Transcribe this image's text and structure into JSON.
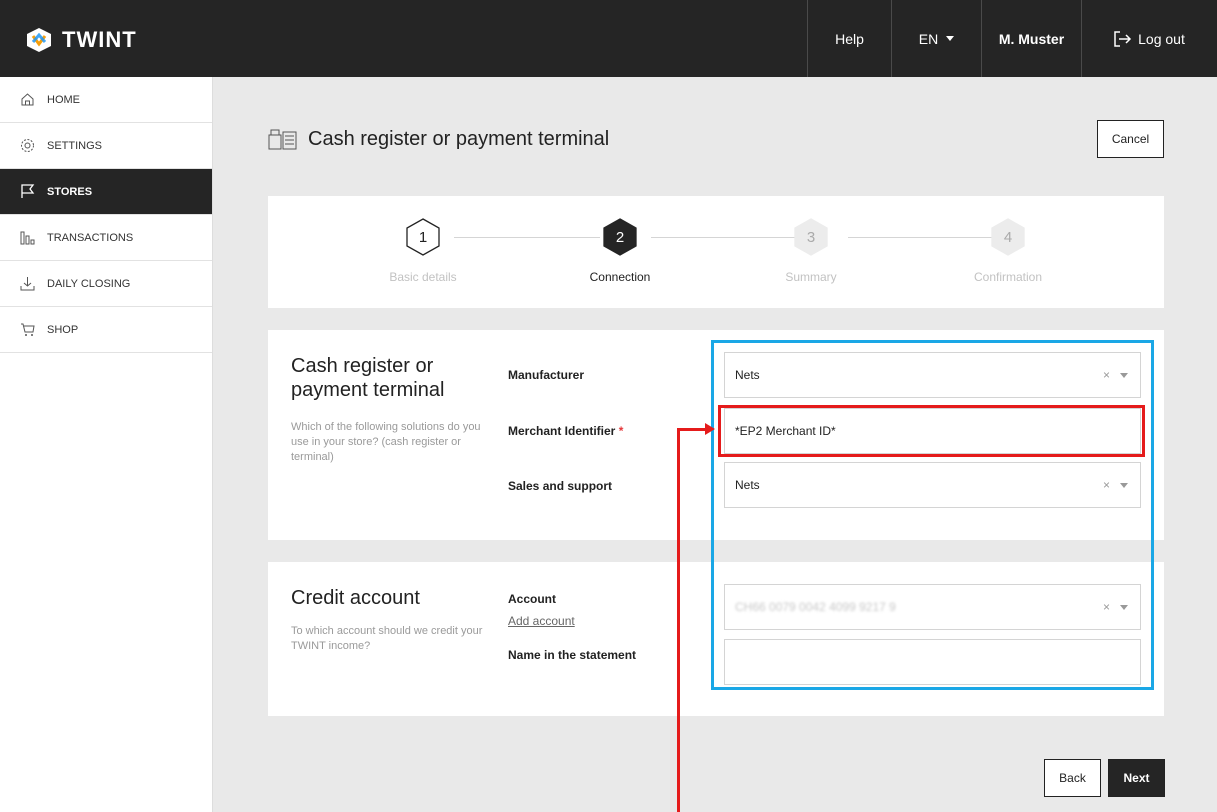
{
  "header": {
    "logo_text": "TWINT",
    "help": "Help",
    "language": "EN",
    "user": "M. Muster",
    "logout": "Log out"
  },
  "sidebar": {
    "items": [
      {
        "label": "HOME",
        "icon": "home-icon"
      },
      {
        "label": "SETTINGS",
        "icon": "gear-icon"
      },
      {
        "label": "STORES",
        "icon": "flag-icon",
        "active": true
      },
      {
        "label": "TRANSACTIONS",
        "icon": "bar-chart-icon"
      },
      {
        "label": "DAILY CLOSING",
        "icon": "download-icon"
      },
      {
        "label": "SHOP",
        "icon": "cart-icon"
      }
    ]
  },
  "page": {
    "title": "Cash register or payment terminal",
    "cancel": "Cancel",
    "back": "Back",
    "next": "Next"
  },
  "stepper": {
    "current": 2,
    "steps": [
      {
        "number": "1",
        "label": "Basic details"
      },
      {
        "number": "2",
        "label": "Connection"
      },
      {
        "number": "3",
        "label": "Summary"
      },
      {
        "number": "4",
        "label": "Confirmation"
      }
    ]
  },
  "terminal_section": {
    "title": "Cash register or payment terminal",
    "description": "Which of the following solutions do you use in your store? (cash register or terminal)",
    "manufacturer_label": "Manufacturer",
    "manufacturer_value": "Nets",
    "merchant_id_label": "Merchant Identifier",
    "required_mark": "*",
    "merchant_id_value": "*EP2 Merchant ID*",
    "sales_support_label": "Sales and support",
    "sales_support_value": "Nets",
    "clear_symbol": "×"
  },
  "credit_section": {
    "title": "Credit account",
    "description": "To which account should we credit your TWINT income?",
    "account_label": "Account",
    "add_account": "Add account",
    "account_value": "CH66 0079 0042 4099 9217 9",
    "statement_label": "Name in the statement",
    "statement_value": ""
  },
  "colors": {
    "dark": "#252525",
    "highlight_blue": "#1aa7e6",
    "highlight_red": "#e51b1b"
  }
}
